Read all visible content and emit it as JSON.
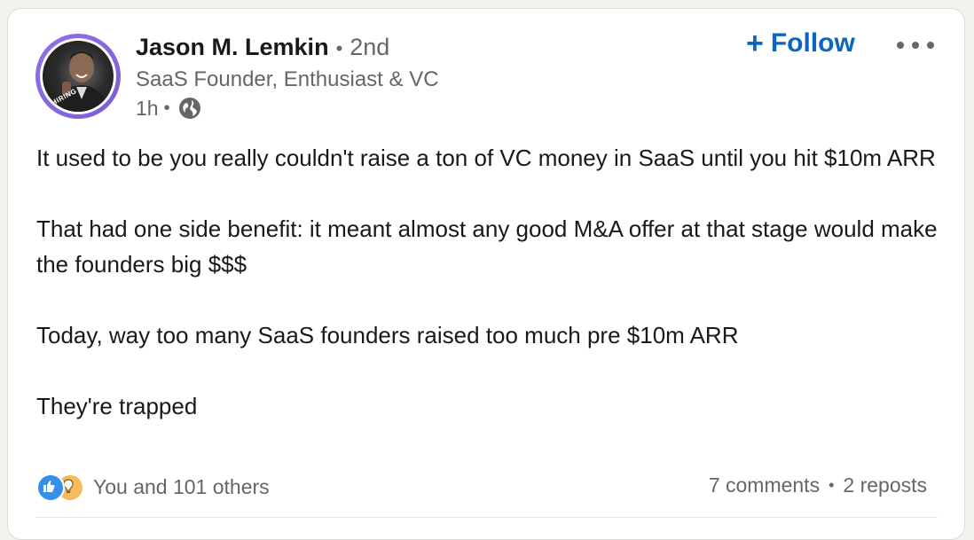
{
  "author": {
    "name": "Jason M. Lemkin",
    "separator": "•",
    "degree": "2nd",
    "headline": "SaaS Founder, Enthusiast & VC",
    "time": "1h",
    "avatar_badge": "#HIRING",
    "visibility_icon": "globe-icon"
  },
  "actions": {
    "follow_plus": "+",
    "follow_label": "Follow",
    "more_icon": "ellipsis-icon"
  },
  "post": {
    "paragraphs": [
      "It used to be you really couldn't raise a ton of VC money in SaaS until you hit $10m ARR",
      "That had one side benefit: it meant almost any good M&A offer at that stage would make the founders big $$$",
      "Today, way too many SaaS founders raised too much pre $10m ARR",
      "They're trapped"
    ]
  },
  "social": {
    "reaction_icons": [
      "like-icon",
      "insightful-icon"
    ],
    "reactions_text": "You and 101 others",
    "comments_text": "7 comments",
    "separator": "•",
    "reposts_text": "2 reposts"
  },
  "colors": {
    "accent": "#0a66c2",
    "secondary_text": "#666666",
    "primary_text": "#191919",
    "avatar_ring": "#8f73e8",
    "like": "#378fe9",
    "insightful": "#f5bb5c"
  }
}
